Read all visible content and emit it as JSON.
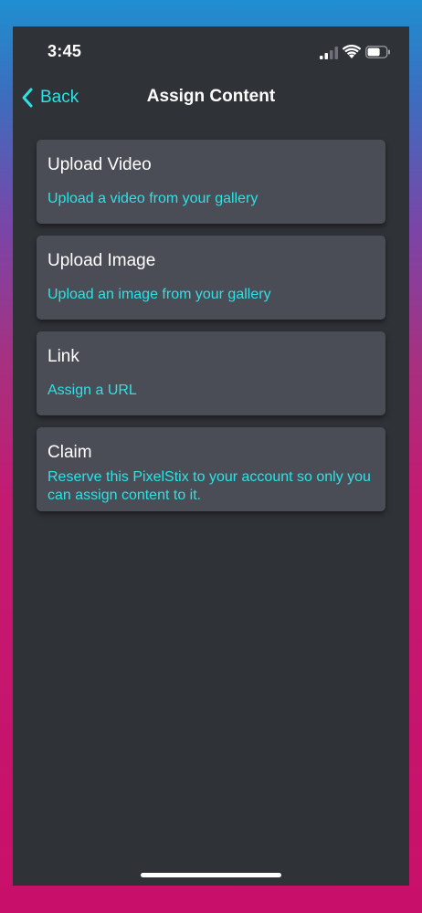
{
  "status": {
    "time": "3:45"
  },
  "nav": {
    "back_label": "Back",
    "title": "Assign Content"
  },
  "cards": [
    {
      "title": "Upload Video",
      "subtitle": "Upload a video from your gallery"
    },
    {
      "title": "Upload Image",
      "subtitle": "Upload an image from your gallery"
    },
    {
      "title": "Link",
      "subtitle": "Assign a URL"
    },
    {
      "title": "Claim",
      "subtitle": "Reserve this PixelStix to your account so only you can assign content to it."
    }
  ],
  "colors": {
    "accent": "#2de2e6",
    "background": "#2f3237",
    "card": "#4a4d55"
  },
  "icons": {
    "back": "chevron-left-icon",
    "signal": "cellular-signal-icon",
    "wifi": "wifi-icon",
    "battery": "battery-icon"
  }
}
